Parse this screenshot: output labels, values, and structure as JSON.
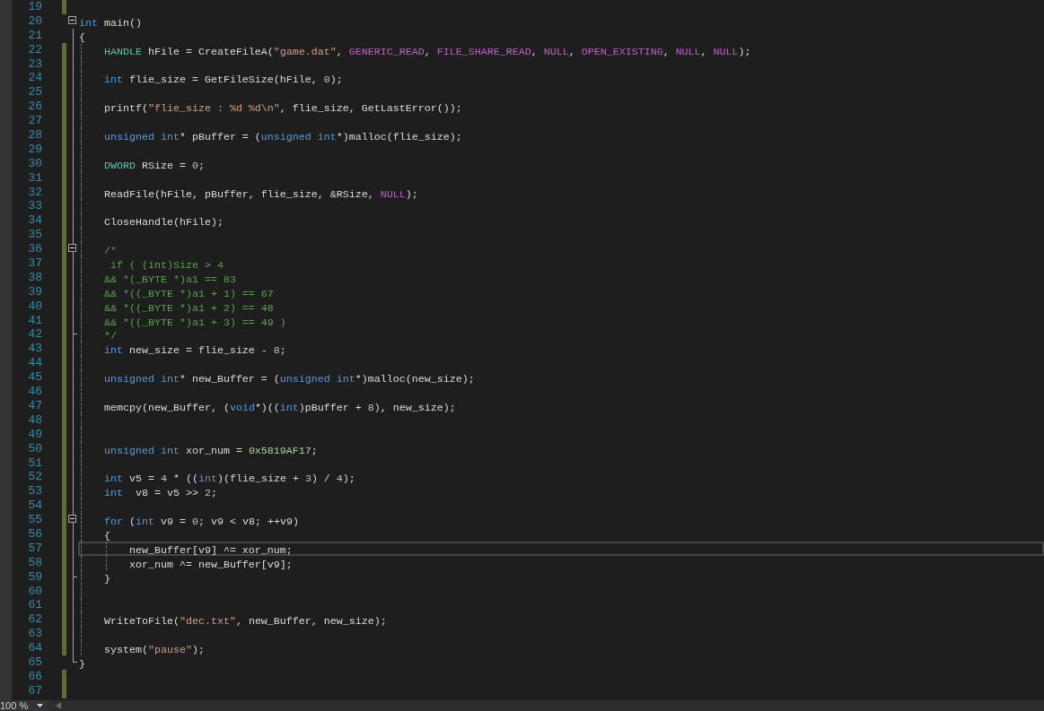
{
  "editor": {
    "lines": [
      {
        "number": "19",
        "modified": true,
        "fold_start": false,
        "fold_end": false,
        "current": false
      },
      {
        "number": "20",
        "modified": false,
        "fold_start": true,
        "fold_end": false,
        "current": false,
        "tokens": [
          {
            "kind": "keyword",
            "text": "int"
          },
          {
            "kind": "plain",
            "text": " main()"
          }
        ]
      },
      {
        "number": "21",
        "modified": false,
        "fold_start": false,
        "fold_end": false,
        "current": false,
        "tokens": [
          {
            "kind": "plain",
            "text": "{"
          }
        ]
      },
      {
        "number": "22",
        "modified": true,
        "fold_start": false,
        "fold_end": false,
        "current": false,
        "tokens": [
          {
            "kind": "type",
            "text": "    HANDLE"
          },
          {
            "kind": "plain",
            "text": " hFile = CreateFileA("
          },
          {
            "kind": "string",
            "text": "\"game.dat\""
          },
          {
            "kind": "plain",
            "text": ", "
          },
          {
            "kind": "macro",
            "text": "GENERIC_READ"
          },
          {
            "kind": "plain",
            "text": ", "
          },
          {
            "kind": "macro",
            "text": "FILE_SHARE_READ"
          },
          {
            "kind": "plain",
            "text": ", "
          },
          {
            "kind": "macro",
            "text": "NULL"
          },
          {
            "kind": "plain",
            "text": ", "
          },
          {
            "kind": "macro",
            "text": "OPEN_EXISTING"
          },
          {
            "kind": "plain",
            "text": ", "
          },
          {
            "kind": "macro",
            "text": "NULL"
          },
          {
            "kind": "plain",
            "text": ", "
          },
          {
            "kind": "macro",
            "text": "NULL"
          },
          {
            "kind": "plain",
            "text": ");"
          }
        ]
      },
      {
        "number": "23",
        "modified": true,
        "fold_start": false,
        "fold_end": false,
        "current": false
      },
      {
        "number": "24",
        "modified": true,
        "fold_start": false,
        "fold_end": false,
        "current": false,
        "tokens": [
          {
            "kind": "keyword",
            "text": "    int"
          },
          {
            "kind": "plain",
            "text": " flie_size = GetFileSize(hFile, "
          },
          {
            "kind": "number",
            "text": "0"
          },
          {
            "kind": "plain",
            "text": ");"
          }
        ]
      },
      {
        "number": "25",
        "modified": true,
        "fold_start": false,
        "fold_end": false,
        "current": false
      },
      {
        "number": "26",
        "modified": true,
        "fold_start": false,
        "fold_end": false,
        "current": false,
        "tokens": [
          {
            "kind": "plain",
            "text": "    printf("
          },
          {
            "kind": "string",
            "text": "\"flie_size : %d %d\\n\""
          },
          {
            "kind": "plain",
            "text": ", flie_size, GetLastError());"
          }
        ]
      },
      {
        "number": "27",
        "modified": true,
        "fold_start": false,
        "fold_end": false,
        "current": false
      },
      {
        "number": "28",
        "modified": true,
        "fold_start": false,
        "fold_end": false,
        "current": false,
        "tokens": [
          {
            "kind": "keyword",
            "text": "    unsigned int"
          },
          {
            "kind": "plain",
            "text": "* pBuffer = ("
          },
          {
            "kind": "keyword",
            "text": "unsigned int"
          },
          {
            "kind": "plain",
            "text": "*)malloc(flie_size);"
          }
        ]
      },
      {
        "number": "29",
        "modified": true,
        "fold_start": false,
        "fold_end": false,
        "current": false
      },
      {
        "number": "30",
        "modified": true,
        "fold_start": false,
        "fold_end": false,
        "current": false,
        "tokens": [
          {
            "kind": "type",
            "text": "    DWORD"
          },
          {
            "kind": "plain",
            "text": " RSize = "
          },
          {
            "kind": "number",
            "text": "0"
          },
          {
            "kind": "plain",
            "text": ";"
          }
        ]
      },
      {
        "number": "31",
        "modified": true,
        "fold_start": false,
        "fold_end": false,
        "current": false
      },
      {
        "number": "32",
        "modified": true,
        "fold_start": false,
        "fold_end": false,
        "current": false,
        "tokens": [
          {
            "kind": "plain",
            "text": "    ReadFile(hFile, pBuffer, flie_size, &RSize, "
          },
          {
            "kind": "macro",
            "text": "NULL"
          },
          {
            "kind": "plain",
            "text": ");"
          }
        ]
      },
      {
        "number": "33",
        "modified": true,
        "fold_start": false,
        "fold_end": false,
        "current": false
      },
      {
        "number": "34",
        "modified": true,
        "fold_start": false,
        "fold_end": false,
        "current": false,
        "tokens": [
          {
            "kind": "plain",
            "text": "    CloseHandle(hFile);"
          }
        ]
      },
      {
        "number": "35",
        "modified": true,
        "fold_start": false,
        "fold_end": false,
        "current": false
      },
      {
        "number": "36",
        "modified": true,
        "fold_start": true,
        "fold_end": false,
        "current": false,
        "tokens": [
          {
            "kind": "comment",
            "text": "    /*"
          }
        ]
      },
      {
        "number": "37",
        "modified": true,
        "fold_start": false,
        "fold_end": false,
        "current": false,
        "tokens": [
          {
            "kind": "comment",
            "text": "     if ( (int)Size > 4"
          }
        ]
      },
      {
        "number": "38",
        "modified": true,
        "fold_start": false,
        "fold_end": false,
        "current": false,
        "tokens": [
          {
            "kind": "comment",
            "text": "    && *(_BYTE *)a1 == 83"
          }
        ]
      },
      {
        "number": "39",
        "modified": true,
        "fold_start": false,
        "fold_end": false,
        "current": false,
        "tokens": [
          {
            "kind": "comment",
            "text": "    && *((_BYTE *)a1 + 1) == 67"
          }
        ]
      },
      {
        "number": "40",
        "modified": true,
        "fold_start": false,
        "fold_end": false,
        "current": false,
        "tokens": [
          {
            "kind": "comment",
            "text": "    && *((_BYTE *)a1 + 2) == 48"
          }
        ]
      },
      {
        "number": "41",
        "modified": true,
        "fold_start": false,
        "fold_end": false,
        "current": false,
        "tokens": [
          {
            "kind": "comment",
            "text": "    && *((_BYTE *)a1 + 3) == 49 )"
          }
        ]
      },
      {
        "number": "42",
        "modified": true,
        "fold_start": false,
        "fold_end": true,
        "current": false,
        "tokens": [
          {
            "kind": "comment",
            "text": "    */"
          }
        ]
      },
      {
        "number": "43",
        "modified": true,
        "fold_start": false,
        "fold_end": false,
        "current": false,
        "tokens": [
          {
            "kind": "keyword",
            "text": "    int"
          },
          {
            "kind": "plain",
            "text": " new_size = flie_size - "
          },
          {
            "kind": "number",
            "text": "8"
          },
          {
            "kind": "plain",
            "text": ";"
          }
        ]
      },
      {
        "number": "44",
        "modified": true,
        "fold_start": false,
        "fold_end": false,
        "current": false
      },
      {
        "number": "45",
        "modified": true,
        "fold_start": false,
        "fold_end": false,
        "current": false,
        "tokens": [
          {
            "kind": "keyword",
            "text": "    unsigned int"
          },
          {
            "kind": "plain",
            "text": "* new_Buffer = ("
          },
          {
            "kind": "keyword",
            "text": "unsigned int"
          },
          {
            "kind": "plain",
            "text": "*)malloc(new_size);"
          }
        ]
      },
      {
        "number": "46",
        "modified": true,
        "fold_start": false,
        "fold_end": false,
        "current": false
      },
      {
        "number": "47",
        "modified": true,
        "fold_start": false,
        "fold_end": false,
        "current": false,
        "tokens": [
          {
            "kind": "plain",
            "text": "    memcpy(new_Buffer, ("
          },
          {
            "kind": "keyword",
            "text": "void"
          },
          {
            "kind": "plain",
            "text": "*)(("
          },
          {
            "kind": "keyword",
            "text": "int"
          },
          {
            "kind": "plain",
            "text": ")pBuffer + "
          },
          {
            "kind": "number",
            "text": "8"
          },
          {
            "kind": "plain",
            "text": "), new_size);"
          }
        ]
      },
      {
        "number": "48",
        "modified": true,
        "fold_start": false,
        "fold_end": false,
        "current": false
      },
      {
        "number": "49",
        "modified": true,
        "fold_start": false,
        "fold_end": false,
        "current": false
      },
      {
        "number": "50",
        "modified": true,
        "fold_start": false,
        "fold_end": false,
        "current": false,
        "tokens": [
          {
            "kind": "keyword",
            "text": "    unsigned int"
          },
          {
            "kind": "plain",
            "text": " xor_num = "
          },
          {
            "kind": "number",
            "text": "0x5819AF17"
          },
          {
            "kind": "plain",
            "text": ";"
          }
        ]
      },
      {
        "number": "51",
        "modified": true,
        "fold_start": false,
        "fold_end": false,
        "current": false
      },
      {
        "number": "52",
        "modified": true,
        "fold_start": false,
        "fold_end": false,
        "current": false,
        "tokens": [
          {
            "kind": "keyword",
            "text": "    int"
          },
          {
            "kind": "plain",
            "text": " v5 = "
          },
          {
            "kind": "number",
            "text": "4"
          },
          {
            "kind": "plain",
            "text": " * (("
          },
          {
            "kind": "keyword",
            "text": "int"
          },
          {
            "kind": "plain",
            "text": ")(flie_size + "
          },
          {
            "kind": "number",
            "text": "3"
          },
          {
            "kind": "plain",
            "text": ") / "
          },
          {
            "kind": "number",
            "text": "4"
          },
          {
            "kind": "plain",
            "text": ");"
          }
        ]
      },
      {
        "number": "53",
        "modified": true,
        "fold_start": false,
        "fold_end": false,
        "current": false,
        "tokens": [
          {
            "kind": "keyword",
            "text": "    int"
          },
          {
            "kind": "plain",
            "text": "  v8 = v5 >> "
          },
          {
            "kind": "number",
            "text": "2"
          },
          {
            "kind": "plain",
            "text": ";"
          }
        ]
      },
      {
        "number": "54",
        "modified": true,
        "fold_start": false,
        "fold_end": false,
        "current": false
      },
      {
        "number": "55",
        "modified": true,
        "fold_start": true,
        "fold_end": false,
        "current": false,
        "tokens": [
          {
            "kind": "keyword",
            "text": "    for"
          },
          {
            "kind": "plain",
            "text": " ("
          },
          {
            "kind": "keyword",
            "text": "int"
          },
          {
            "kind": "plain",
            "text": " v9 = "
          },
          {
            "kind": "number",
            "text": "0"
          },
          {
            "kind": "plain",
            "text": "; v9 < v8; ++v9)"
          }
        ]
      },
      {
        "number": "56",
        "modified": true,
        "fold_start": false,
        "fold_end": false,
        "current": false,
        "tokens": [
          {
            "kind": "plain",
            "text": "    {"
          }
        ]
      },
      {
        "number": "57",
        "modified": true,
        "fold_start": false,
        "fold_end": false,
        "current": true,
        "tokens": [
          {
            "kind": "plain",
            "text": "        new_Buffer[v9] ^= xor_num;"
          }
        ]
      },
      {
        "number": "58",
        "modified": true,
        "fold_start": false,
        "fold_end": false,
        "current": false,
        "tokens": [
          {
            "kind": "plain",
            "text": "        xor_num ^= new_Buffer[v9];"
          }
        ]
      },
      {
        "number": "59",
        "modified": true,
        "fold_start": false,
        "fold_end": true,
        "current": false,
        "tokens": [
          {
            "kind": "plain",
            "text": "    }"
          }
        ]
      },
      {
        "number": "60",
        "modified": true,
        "fold_start": false,
        "fold_end": false,
        "current": false
      },
      {
        "number": "61",
        "modified": true,
        "fold_start": false,
        "fold_end": false,
        "current": false
      },
      {
        "number": "62",
        "modified": true,
        "fold_start": false,
        "fold_end": false,
        "current": false,
        "tokens": [
          {
            "kind": "plain",
            "text": "    WriteToFile("
          },
          {
            "kind": "string",
            "text": "\"dec.txt\""
          },
          {
            "kind": "plain",
            "text": ", new_Buffer, new_size);"
          }
        ]
      },
      {
        "number": "63",
        "modified": true,
        "fold_start": false,
        "fold_end": false,
        "current": false
      },
      {
        "number": "64",
        "modified": true,
        "fold_start": false,
        "fold_end": false,
        "current": false,
        "tokens": [
          {
            "kind": "plain",
            "text": "    system("
          },
          {
            "kind": "string",
            "text": "\"pause\""
          },
          {
            "kind": "plain",
            "text": ");"
          }
        ]
      },
      {
        "number": "65",
        "modified": false,
        "fold_start": false,
        "fold_end": true,
        "current": false,
        "tokens": [
          {
            "kind": "plain",
            "text": "}"
          }
        ]
      },
      {
        "number": "66",
        "modified": true,
        "fold_start": false,
        "fold_end": false,
        "current": false
      },
      {
        "number": "67",
        "modified": true,
        "fold_start": false,
        "fold_end": false,
        "current": false
      }
    ]
  },
  "status_bar": {
    "zoom": "100 %"
  }
}
